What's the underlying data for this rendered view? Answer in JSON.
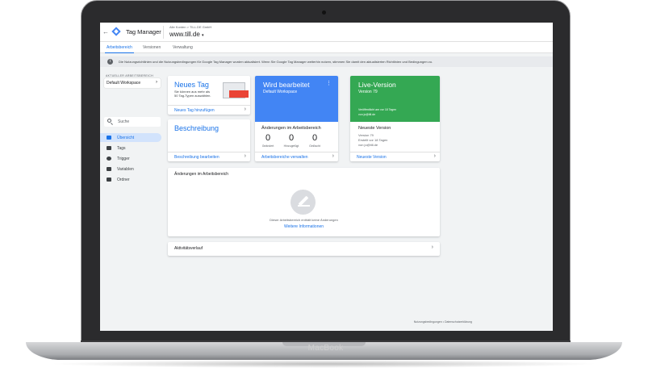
{
  "device": {
    "brand": "MacBook"
  },
  "header": {
    "app_title": "Tag Manager",
    "account_line": "Alle Konten > TILL.DE GmbH",
    "container_name": "www.till.de",
    "container_chevron": "▾",
    "back_arrow": "←"
  },
  "tabs": [
    {
      "label": "Arbeitsbereich",
      "active": true
    },
    {
      "label": "Versionen",
      "active": false
    },
    {
      "label": "Verwaltung",
      "active": false
    }
  ],
  "notice": {
    "icon": "info-icon",
    "text": "Die Nutzungsrichtlinien und die Nutzungsbedingungen für Google Tag Manager wurden aktualisiert. Wenn Sie Google Tag Manager weiterhin nutzen, stimmen Sie damit den aktualisierten Richtlinien und Bedingungen zu."
  },
  "sidebar": {
    "workspace_label": "AKTUELLER ARBEITSBEREICH",
    "workspace_value": "Default Workspace",
    "search_placeholder": "Suche",
    "items": [
      {
        "label": "Übersicht",
        "icon": "overview-icon",
        "active": true
      },
      {
        "label": "Tags",
        "icon": "tag-icon",
        "active": false
      },
      {
        "label": "Trigger",
        "icon": "trigger-icon",
        "active": false
      },
      {
        "label": "Variablen",
        "icon": "variable-icon",
        "active": false
      },
      {
        "label": "Ordner",
        "icon": "folder-icon",
        "active": false
      }
    ]
  },
  "new_tag_card": {
    "title": "Neues Tag",
    "description": "Sie können aus mehr als 50 Tag-Typen auswählen.",
    "link": "Neues Tag hinzufügen"
  },
  "editing_card": {
    "title": "Wird bearbeitet",
    "subtitle": "Default Workspace",
    "changes_title": "Änderungen im Arbeitsbereich",
    "counters": [
      {
        "value": "0",
        "label": "Geändert"
      },
      {
        "value": "0",
        "label": "Hinzugefügt"
      },
      {
        "value": "0",
        "label": "Gelöscht"
      }
    ],
    "link": "Arbeitsbereiche verwalten"
  },
  "live_card": {
    "title": "Live-Version",
    "subtitle": "Version 79",
    "published_line": "Veröffentlicht am vor 18 Tagen",
    "published_by": "von jo@till.de",
    "latest_title": "Neueste Version",
    "latest_version": "Version 79",
    "created_line": "Erstellt vor 18 Tagen",
    "created_by": "von jo@till.de",
    "link": "Neueste Version"
  },
  "description_card": {
    "title": "Beschreibung",
    "link": "Beschreibung bearbeiten"
  },
  "changes_panel": {
    "title": "Änderungen im Arbeitsbereich",
    "empty_text": "Dieser Arbeitsbereich enthält keine Änderungen",
    "more_link": "Weitere Informationen"
  },
  "history_panel": {
    "title": "Aktivitätsverlauf"
  },
  "footer": {
    "links": "Nutzungsbedingungen • Datenschutzerklärung"
  },
  "colors": {
    "accent": "#1a73e8",
    "blue_banner": "#4285f4",
    "green_banner": "#34a853"
  }
}
